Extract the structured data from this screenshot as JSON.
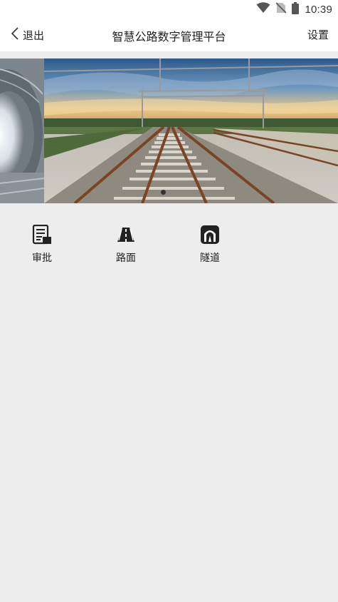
{
  "status_bar": {
    "time": "10:39",
    "icons": [
      "wifi-icon",
      "no-sim-icon",
      "battery-icon"
    ]
  },
  "nav": {
    "back_label": "退出",
    "title": "智慧公路数字管理平台",
    "settings_label": "设置"
  },
  "banner": {
    "slide_count": 2,
    "active_slide": 1,
    "images": [
      "tunnel-photo",
      "railway-track-photo"
    ]
  },
  "functions": [
    {
      "label": "审批",
      "icon": "approval-icon"
    },
    {
      "label": "路面",
      "icon": "road-surface-icon"
    },
    {
      "label": "隧道",
      "icon": "tunnel-icon"
    }
  ],
  "colors": {
    "page_background": "#ededed",
    "bar_background": "#ffffff",
    "text": "#222222",
    "icon": "#222222"
  }
}
